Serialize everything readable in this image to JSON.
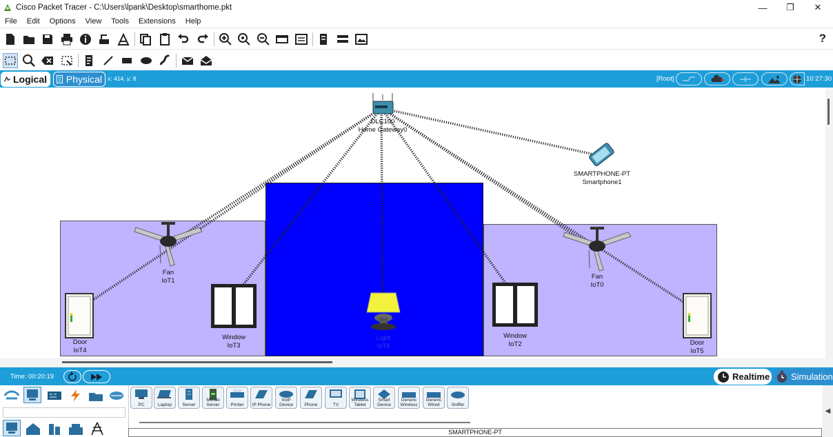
{
  "window": {
    "title": "Cisco Packet Tracer - C:\\Users\\lpank\\Desktop\\smarthome.pkt",
    "minimize_label": "—",
    "maximize_label": "❐",
    "close_label": "✕"
  },
  "menu": [
    "File",
    "Edit",
    "Options",
    "View",
    "Tools",
    "Extensions",
    "Help"
  ],
  "toolbar": {
    "help_label": "?"
  },
  "modebar": {
    "logical_label": "Logical",
    "physical_label": "Physical",
    "coords": "x: 414, y: 8",
    "root_label": "[Root]",
    "clock": "10:27:30"
  },
  "devices": {
    "gateway": {
      "model": "DLC100",
      "name": "Home Gateway0"
    },
    "smartphone": {
      "model": "SMARTPHONE-PT",
      "name": "Smartphone1"
    },
    "fan1": {
      "model": "Fan",
      "name": "IoT1"
    },
    "fan0": {
      "model": "Fan",
      "name": "IoT0"
    },
    "door4": {
      "model": "Door",
      "name": "IoT4"
    },
    "door5": {
      "model": "Door",
      "name": "IoT5"
    },
    "window3": {
      "model": "Window",
      "name": "IoT3"
    },
    "window2": {
      "model": "Window",
      "name": "IoT2"
    },
    "light": {
      "model": "Light",
      "name": "IoT6"
    }
  },
  "colors": {
    "room_side": "#c0b3ff",
    "room_center": "#0000ff",
    "accent": "#1e9ed9"
  },
  "status": {
    "time_label": "Time: 00:20:19",
    "realtime_label": "Realtime",
    "simulation_label": "Simulation"
  },
  "palette": {
    "devices": [
      "PC",
      "Laptop",
      "Server",
      "Meraki Server",
      "Printer",
      "IP Phone",
      "VoIP Device",
      "Phone",
      "TV",
      "Wireless Tablet",
      "Smart Device",
      "Generic Wireless",
      "Generic Wired",
      "Sniffer"
    ],
    "selected": "SMARTPHONE-PT"
  }
}
